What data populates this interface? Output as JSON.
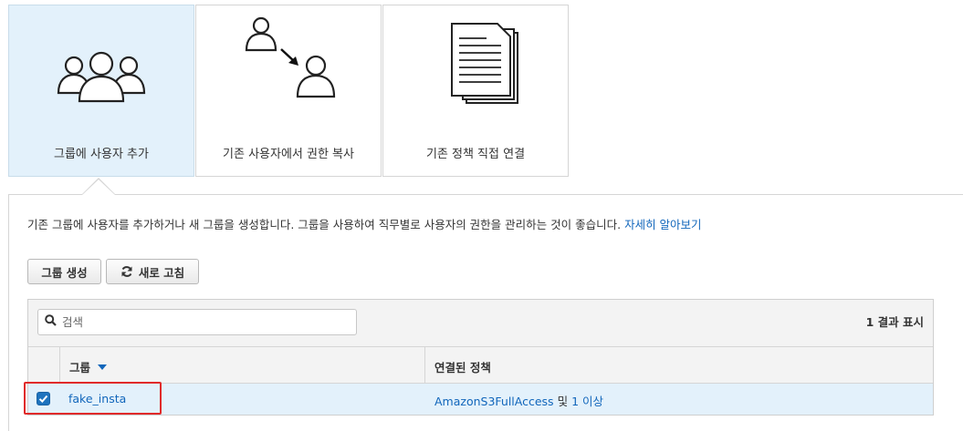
{
  "cards": [
    {
      "label": "그룹에 사용자 추가",
      "icon": "users-group-icon",
      "selected": true
    },
    {
      "label": "기존 사용자에서 권한 복사",
      "icon": "copy-permissions-icon",
      "selected": false
    },
    {
      "label": "기존 정책 직접 연결",
      "icon": "policy-document-icon",
      "selected": false
    }
  ],
  "panel": {
    "description": "기존 그룹에 사용자를 추가하거나 새 그룹을 생성합니다. 그룹을 사용하여 직무별로 사용자의 권한을 관리하는 것이 좋습니다.",
    "learn_more": "자세히 알아보기"
  },
  "toolbar": {
    "create_group": "그룹 생성",
    "refresh": "새로 고침",
    "refresh_icon": "refresh-icon"
  },
  "search": {
    "placeholder": "검색",
    "value": "",
    "icon": "search-icon"
  },
  "result_count": "1 결과 표시",
  "table": {
    "columns": {
      "group": "그룹",
      "policies": "연결된 정책"
    },
    "sort_icon": "sort-down-icon",
    "rows": [
      {
        "checked": true,
        "name": "fake_insta",
        "policy_link": "AmazonS3FullAccess",
        "policy_conj": "및",
        "policy_more": "1 이상"
      }
    ]
  },
  "colors": {
    "accent": "#1166bb",
    "selected_bg": "#e3f1fb",
    "highlight": "#e02a2a"
  }
}
